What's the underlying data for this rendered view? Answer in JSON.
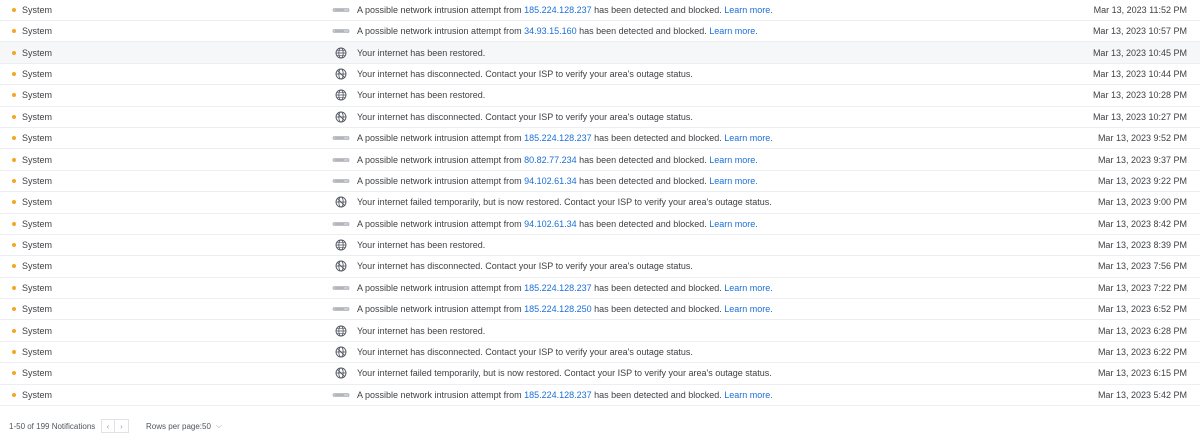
{
  "rows": [
    {
      "source": "System",
      "icon": "device-icon",
      "pre": "A possible network intrusion attempt from ",
      "ip": "185.224.128.237",
      "post": " has been detected and blocked. ",
      "link": "Learn more.",
      "time": "Mar 13, 2023 11:52 PM"
    },
    {
      "source": "System",
      "icon": "device-icon",
      "pre": "A possible network intrusion attempt from ",
      "ip": "34.93.15.160",
      "post": " has been detected and blocked. ",
      "link": "Learn more.",
      "time": "Mar 13, 2023 10:57 PM"
    },
    {
      "source": "System",
      "icon": "globe-icon",
      "text": "Your internet has been restored.",
      "time": "Mar 13, 2023 10:45 PM"
    },
    {
      "source": "System",
      "icon": "globe-off-icon",
      "text": "Your internet has disconnected. Contact your ISP to verify your area's outage status.",
      "time": "Mar 13, 2023 10:44 PM"
    },
    {
      "source": "System",
      "icon": "globe-icon",
      "text": "Your internet has been restored.",
      "time": "Mar 13, 2023 10:28 PM"
    },
    {
      "source": "System",
      "icon": "globe-off-icon",
      "text": "Your internet has disconnected. Contact your ISP to verify your area's outage status.",
      "time": "Mar 13, 2023 10:27 PM"
    },
    {
      "source": "System",
      "icon": "device-icon",
      "pre": "A possible network intrusion attempt from ",
      "ip": "185.224.128.237",
      "post": " has been detected and blocked. ",
      "link": "Learn more.",
      "time": "Mar 13, 2023 9:52 PM"
    },
    {
      "source": "System",
      "icon": "device-icon",
      "pre": "A possible network intrusion attempt from ",
      "ip": "80.82.77.234",
      "post": " has been detected and blocked. ",
      "link": "Learn more.",
      "time": "Mar 13, 2023 9:37 PM"
    },
    {
      "source": "System",
      "icon": "device-icon",
      "pre": "A possible network intrusion attempt from ",
      "ip": "94.102.61.34",
      "post": " has been detected and blocked. ",
      "link": "Learn more.",
      "time": "Mar 13, 2023 9:22 PM"
    },
    {
      "source": "System",
      "icon": "globe-off-icon",
      "text": "Your internet failed temporarily, but is now restored. Contact your ISP to verify your area's outage status.",
      "time": "Mar 13, 2023 9:00 PM"
    },
    {
      "source": "System",
      "icon": "device-icon",
      "pre": "A possible network intrusion attempt from ",
      "ip": "94.102.61.34",
      "post": " has been detected and blocked. ",
      "link": "Learn more.",
      "time": "Mar 13, 2023 8:42 PM"
    },
    {
      "source": "System",
      "icon": "globe-icon",
      "text": "Your internet has been restored.",
      "time": "Mar 13, 2023 8:39 PM"
    },
    {
      "source": "System",
      "icon": "globe-off-icon",
      "text": "Your internet has disconnected. Contact your ISP to verify your area's outage status.",
      "time": "Mar 13, 2023 7:56 PM"
    },
    {
      "source": "System",
      "icon": "device-icon",
      "pre": "A possible network intrusion attempt from ",
      "ip": "185.224.128.237",
      "post": " has been detected and blocked. ",
      "link": "Learn more.",
      "time": "Mar 13, 2023 7:22 PM"
    },
    {
      "source": "System",
      "icon": "device-icon",
      "pre": "A possible network intrusion attempt from ",
      "ip": "185.224.128.250",
      "post": " has been detected and blocked. ",
      "link": "Learn more.",
      "time": "Mar 13, 2023 6:52 PM"
    },
    {
      "source": "System",
      "icon": "globe-icon",
      "text": "Your internet has been restored.",
      "time": "Mar 13, 2023 6:28 PM"
    },
    {
      "source": "System",
      "icon": "globe-off-icon",
      "text": "Your internet has disconnected. Contact your ISP to verify your area's outage status.",
      "time": "Mar 13, 2023 6:22 PM"
    },
    {
      "source": "System",
      "icon": "globe-off-icon",
      "text": "Your internet failed temporarily, but is now restored. Contact your ISP to verify your area's outage status.",
      "time": "Mar 13, 2023 6:15 PM"
    },
    {
      "source": "System",
      "icon": "device-icon",
      "pre": "A possible network intrusion attempt from ",
      "ip": "185.224.128.237",
      "post": " has been detected and blocked. ",
      "link": "Learn more.",
      "time": "Mar 13, 2023 5:42 PM"
    }
  ],
  "footer": {
    "count": "1-50 of 199 Notifications",
    "rows_per_page_label": "Rows per page:",
    "rows_per_page_value": "50"
  },
  "colors": {
    "status_dot": "#f5a524",
    "link": "#1a6fd8"
  }
}
